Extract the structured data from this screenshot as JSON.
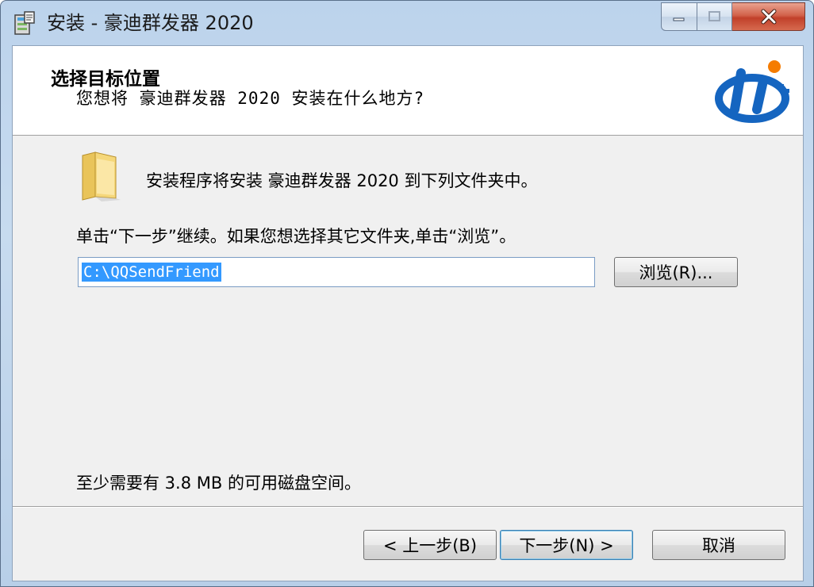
{
  "window": {
    "title": "安装 - 豪迪群发器 2020"
  },
  "header": {
    "title": "选择目标位置",
    "subtitle": "您想将 豪迪群发器 2020 安装在什么地方?"
  },
  "body": {
    "intro": "安装程序将安装 豪迪群发器 2020 到下列文件夹中。",
    "instruction": "单击“下一步”继续。如果您想选择其它文件夹,单击“浏览”。",
    "path_value": "C:\\QQSendFriend",
    "browse_label": "浏览(R)...",
    "space_note": "至少需要有 3.8 MB 的可用磁盘空间。"
  },
  "footer": {
    "back_label": "< 上一步(B)",
    "next_label": "下一步(N) >",
    "cancel_label": "取消"
  },
  "icons": {
    "app": "installer-icon",
    "folder": "folder-icon",
    "logo": "brand-logo"
  },
  "colors": {
    "selection": "#3399ff",
    "close_button": "#c1402a",
    "logo_blue": "#1565c0",
    "logo_orange": "#f57c00"
  }
}
